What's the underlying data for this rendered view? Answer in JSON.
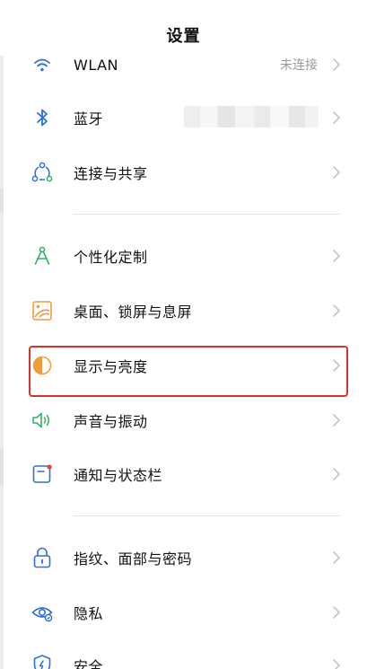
{
  "header": {
    "title": "设置"
  },
  "colors": {
    "accent": "#2f7fe0",
    "highlight": "#d9322e",
    "icon_blue": "#2f6fd8",
    "icon_orange": "#f29b3a",
    "icon_green": "#2fb36b"
  },
  "rows": {
    "wlan": {
      "label": "WLAN",
      "value": "未连接",
      "icon": "wifi-icon"
    },
    "bluetooth": {
      "label": "蓝牙",
      "icon": "bluetooth-icon"
    },
    "share": {
      "label": "连接与共享",
      "icon": "share-icon"
    },
    "personal": {
      "label": "个性化定制",
      "icon": "compass-icon"
    },
    "desktop": {
      "label": "桌面、锁屏与息屏",
      "icon": "wallpaper-icon"
    },
    "display": {
      "label": "显示与亮度",
      "icon": "brightness-icon"
    },
    "sound": {
      "label": "声音与振动",
      "icon": "speaker-icon"
    },
    "notify": {
      "label": "通知与状态栏",
      "icon": "notification-icon"
    },
    "biometric": {
      "label": "指纹、面部与密码",
      "icon": "lock-icon"
    },
    "privacy": {
      "label": "隐私",
      "icon": "eye-icon"
    },
    "security": {
      "label": "安全",
      "icon": "shield-icon"
    }
  }
}
